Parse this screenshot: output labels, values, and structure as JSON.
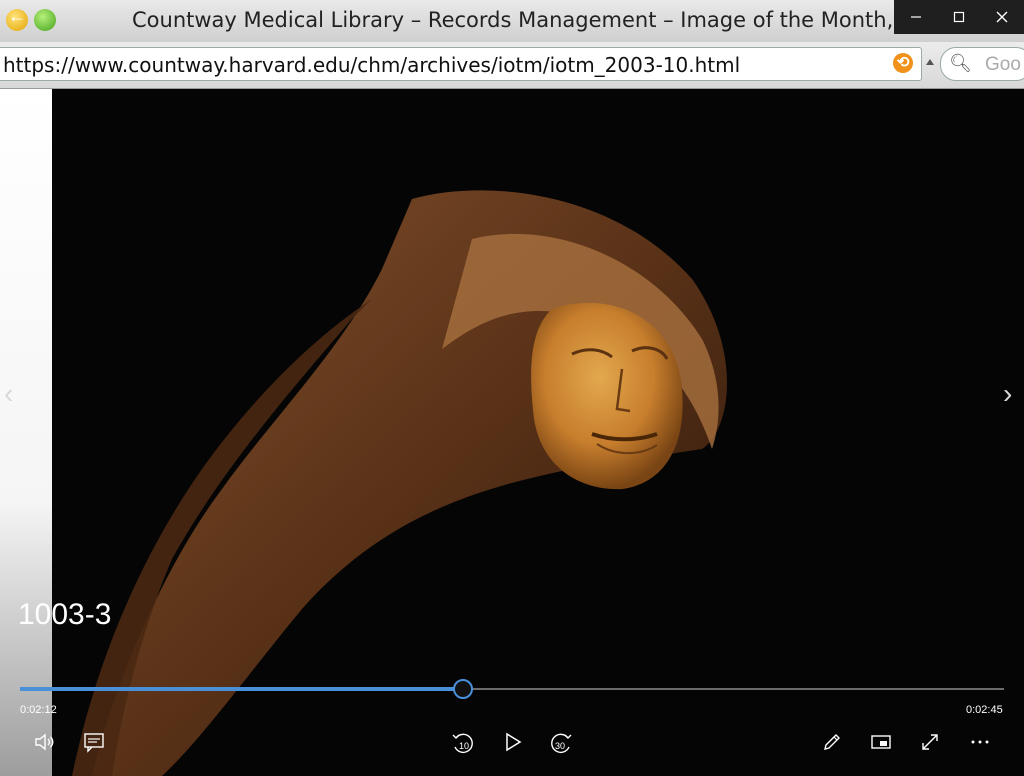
{
  "browser": {
    "window_title": "Countway Medical Library – Records Management – Image of the Month, Ju",
    "url": "https://www.countway.harvard.edu/chm/archives/iotm/iotm_2003-10.html",
    "search_placeholder": "Goo"
  },
  "video": {
    "title": "1003-3",
    "current_time": "0:02:12",
    "total_time": "0:02:45",
    "progress": 0.45
  },
  "icons": {
    "window": [
      "minimize-icon",
      "maximize-icon",
      "close-icon"
    ],
    "player": [
      "volume-icon",
      "captions-icon",
      "rewind-10-icon",
      "play-icon",
      "forward-30-icon",
      "edit-icon",
      "mini-view-icon",
      "fullscreen-icon",
      "more-icon"
    ]
  },
  "colors": {
    "accent": "#4a90d9"
  }
}
